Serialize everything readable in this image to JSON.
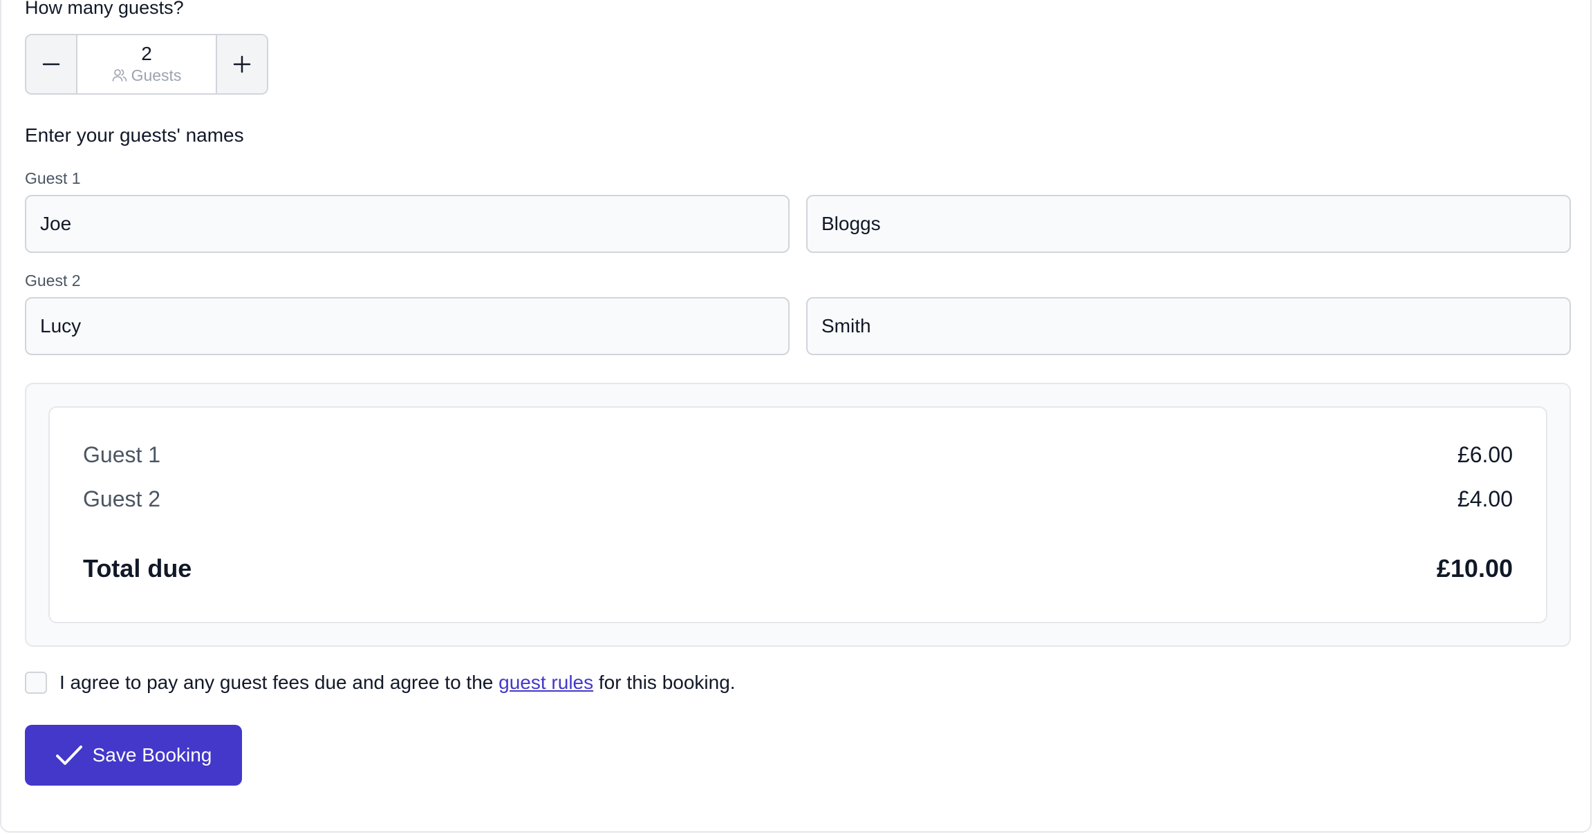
{
  "guests_question": "How many guests?",
  "stepper": {
    "value": "2",
    "unit": "Guests",
    "decrement_icon": "minus-icon",
    "increment_icon": "plus-icon",
    "unit_icon": "users-icon"
  },
  "names_heading": "Enter your guests' names",
  "guests": [
    {
      "label": "Guest 1",
      "first_name": "Joe",
      "last_name": "Bloggs"
    },
    {
      "label": "Guest 2",
      "first_name": "Lucy",
      "last_name": "Smith"
    }
  ],
  "summary": {
    "lines": [
      {
        "name": "Guest 1",
        "amount": "£6.00"
      },
      {
        "name": "Guest 2",
        "amount": "£4.00"
      }
    ],
    "total_label": "Total due",
    "total_amount": "£10.00"
  },
  "agreement": {
    "text_before": "I agree to pay any guest fees due and agree to the",
    "link_text": "guest rules",
    "text_after": "for this booking."
  },
  "save_button": {
    "label": "Save Booking",
    "icon": "check-icon"
  },
  "colors": {
    "primary": "#4338ca",
    "border": "#d1d5db",
    "muted": "#4b5563"
  }
}
